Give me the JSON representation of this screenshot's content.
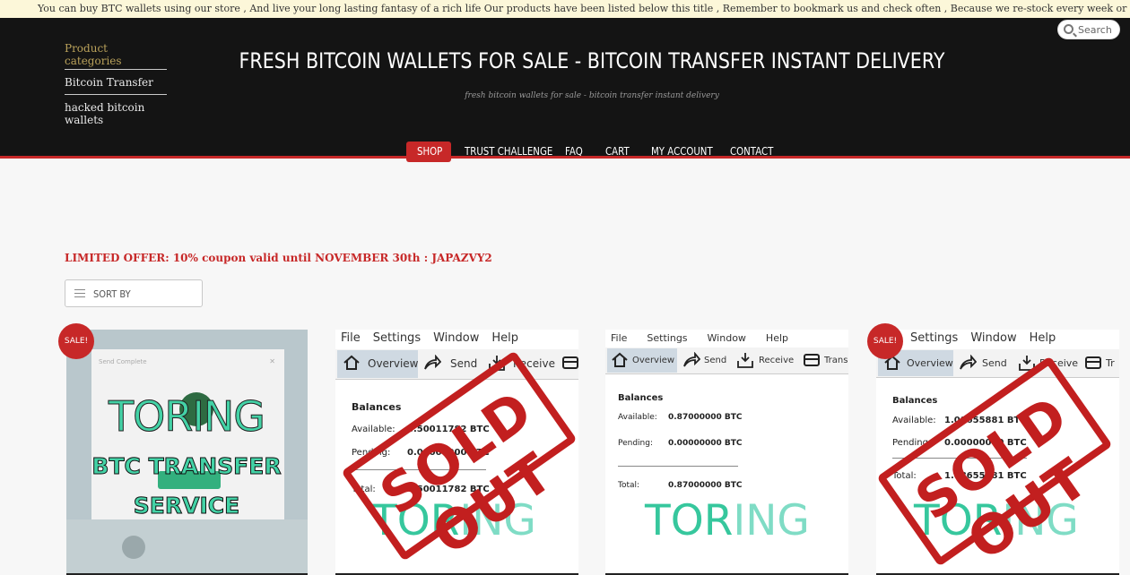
{
  "ticker": {
    "text": "You can buy BTC wallets using our store , And live your long lasting fantasy of a rich life Our products have been listed below this title , Remember to bookmark us and check often , Because we re-stock every week or two with new wallets and balances ☬ Dis"
  },
  "sidebar": {
    "title": "Product categories",
    "items": [
      {
        "label": "Bitcoin Transfer"
      },
      {
        "label": "hacked bitcoin wallets"
      }
    ]
  },
  "header": {
    "title": "FRESH BITCOIN WALLETS FOR SALE - BITCOIN TRANSFER INSTANT DELIVERY",
    "tagline": "fresh bitcoin wallets for sale - bitcoin transfer instant delivery",
    "search_label": "Search"
  },
  "nav": {
    "items": [
      {
        "label": "SHOP"
      },
      {
        "label": "TRUST CHALLENGE"
      },
      {
        "label": "FAQ"
      },
      {
        "label": "CART"
      },
      {
        "label": "MY ACCOUNT"
      },
      {
        "label": "CONTACT"
      }
    ]
  },
  "offer": {
    "text": "LIMITED OFFER: 10% coupon valid until NOVEMBER 30th :",
    "code": "JAPAZVY2"
  },
  "sort": {
    "label": "SORT BY"
  },
  "products": [
    {
      "badge": "SALE!",
      "brand": "TORING",
      "line1": "BTC TRANSFER",
      "line2": "SERVICE"
    },
    {
      "menu": [
        "File",
        "Settings",
        "Window",
        "Help"
      ],
      "toolbar": [
        "Overview",
        "Send",
        "Receive"
      ],
      "balances_title": "Balances",
      "available_label": "Available:",
      "available_value": "8.50011782 BTC",
      "pending_label": "Pending:",
      "pending_value": "0.00000000 BTC",
      "total_label": "Total:",
      "total_value": "8.50011782 BTC",
      "stamp": "SOLD OUT",
      "logo_a": "TOR",
      "logo_b": "ING"
    },
    {
      "menu": [
        "File",
        "Settings",
        "Window",
        "Help"
      ],
      "toolbar": [
        "Overview",
        "Send",
        "Receive",
        "Trans"
      ],
      "balances_title": "Balances",
      "available_label": "Available:",
      "available_value": "0.87000000 BTC",
      "pending_label": "Pending:",
      "pending_value": "0.00000000 BTC",
      "total_label": "Total:",
      "total_value": "0.87000000 BTC",
      "logo_a": "TOR",
      "logo_b": "ING"
    },
    {
      "badge": "SALE!",
      "menu": [
        "Settings",
        "Window",
        "Help"
      ],
      "toolbar": [
        "Overview",
        "Send",
        "Receive",
        "Tr"
      ],
      "balances_title": "Balances",
      "available_label": "Available:",
      "available_value": "1.08655881 BTC",
      "pending_label": "Pending:",
      "pending_value": "0.00000000 BTC",
      "total_label": "Total:",
      "total_value": "1.08655881 BTC",
      "stamp": "SOLD OUT",
      "logo_a": "TOR",
      "logo_b": "ING"
    }
  ]
}
